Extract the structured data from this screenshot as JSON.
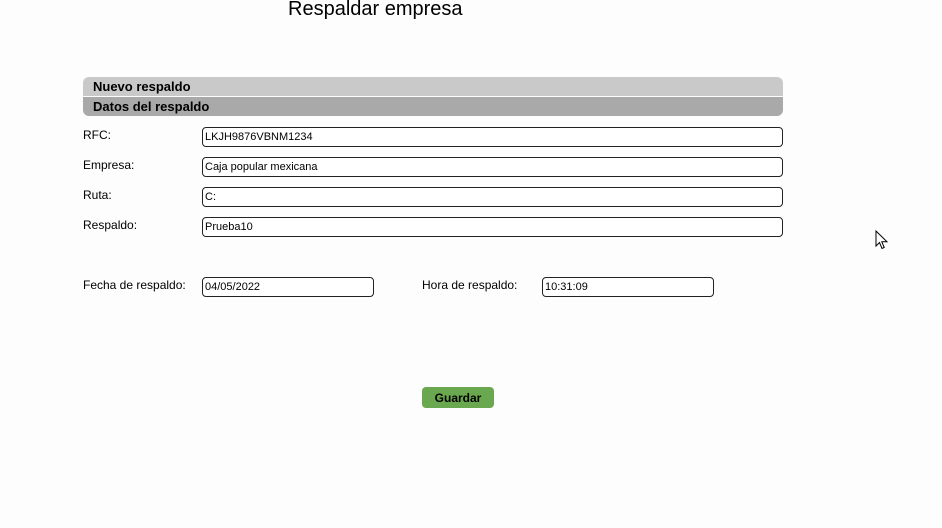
{
  "page": {
    "title": "Respaldar empresa"
  },
  "sections": {
    "new_backup": "Nuevo respaldo",
    "backup_data": "Datos del respaldo"
  },
  "form": {
    "rfc": {
      "label": "RFC:",
      "value": "LKJH9876VBNM1234"
    },
    "empresa": {
      "label": "Empresa:",
      "value": "Caja popular mexicana"
    },
    "ruta": {
      "label": "Ruta:",
      "value": "C:"
    },
    "respaldo": {
      "label": "Respaldo:",
      "value": "Prueba10"
    },
    "fecha": {
      "label": "Fecha de respaldo:",
      "value": "04/05/2022"
    },
    "hora": {
      "label": "Hora de respaldo:",
      "value": "10:31:09"
    }
  },
  "actions": {
    "save_label": "Guardar"
  },
  "colors": {
    "save_button": "#6aa84f",
    "section_new": "#c9c9c9",
    "section_data": "#a9a9a9"
  },
  "icons": {
    "cursor": "mouse-pointer-icon"
  }
}
